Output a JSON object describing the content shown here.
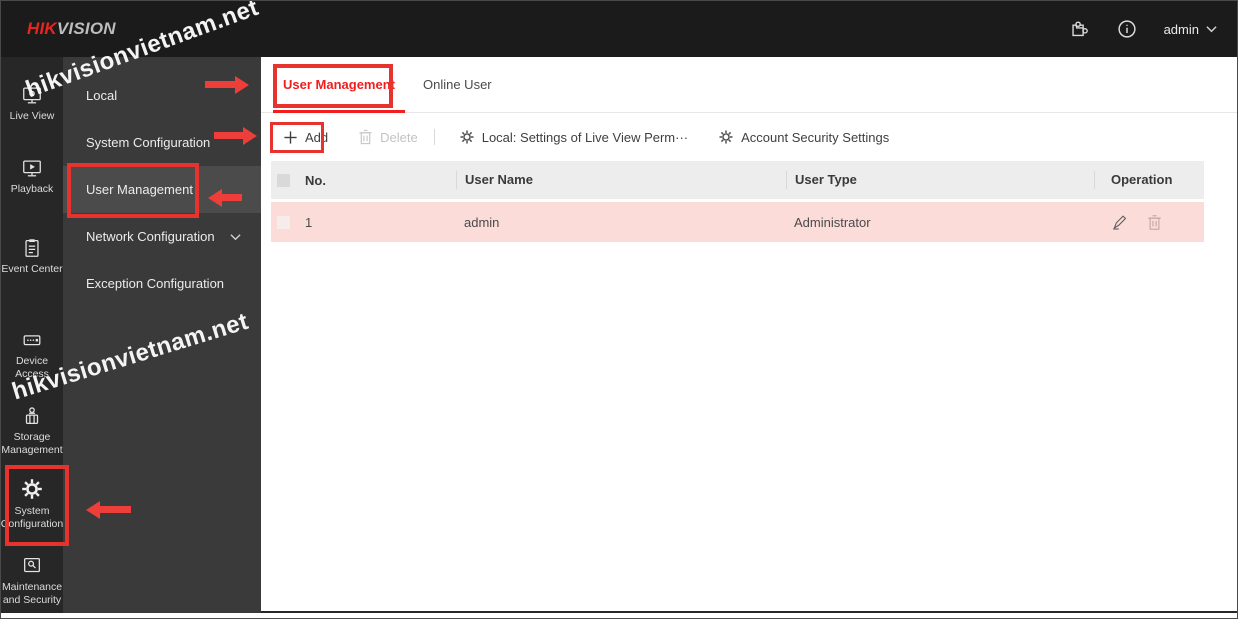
{
  "topbar": {
    "logo": {
      "hik": "HIK",
      "vision": "VISION"
    },
    "icons": {
      "plugin": "puzzle-icon",
      "about": "info-icon"
    },
    "user_menu": {
      "label": "admin",
      "chevron": "chevron-down-icon"
    }
  },
  "left_sidebar": {
    "items": [
      {
        "label": "Live View",
        "icon": "live-view-monitor-icon"
      },
      {
        "label": "Playback",
        "icon": "playback-icon"
      },
      {
        "label": "Event Center",
        "icon": "event-clipboard-icon"
      },
      {
        "label": "Device Access",
        "icon": "device-access-icon"
      },
      {
        "label": "Storage Management",
        "icon": "storage-icon"
      },
      {
        "label": "System Configuration",
        "icon": "gear-icon"
      },
      {
        "label": "Maintenance and Security",
        "icon": "maintenance-icon"
      }
    ]
  },
  "sub_sidebar": {
    "items": [
      {
        "label": "Local"
      },
      {
        "label": "System Configuration"
      },
      {
        "label": "User Management",
        "selected": true
      },
      {
        "label": "Network Configuration",
        "has_submenu": true
      },
      {
        "label": "Exception Configuration"
      }
    ]
  },
  "tabs": [
    {
      "label": "User Management",
      "active": true
    },
    {
      "label": "Online User",
      "active": false
    }
  ],
  "toolbar": {
    "add_label": "Add",
    "delete_label": "Delete",
    "live_view_perm_label": "Local: Settings of Live View Perm···",
    "account_security_label": "Account Security Settings"
  },
  "table": {
    "columns": {
      "no": "No.",
      "user_name": "User Name",
      "user_type": "User Type",
      "operation": "Operation"
    },
    "rows": [
      {
        "no": "1",
        "user_name": "admin",
        "user_type": "Administrator"
      }
    ]
  },
  "watermark": {
    "text": "hikvisionvietnam.net"
  },
  "colors": {
    "accent_red": "#f21d1d",
    "annotation_red": "#e6332d",
    "row_highlight": "#fbdcd9",
    "table_header_bg": "#ededed",
    "topbar_bg": "#1b1b1b",
    "sidebar_bg": "#272727",
    "subsidebar_bg": "#3a3a3a",
    "selected_item_bg": "#4b4b4b"
  }
}
